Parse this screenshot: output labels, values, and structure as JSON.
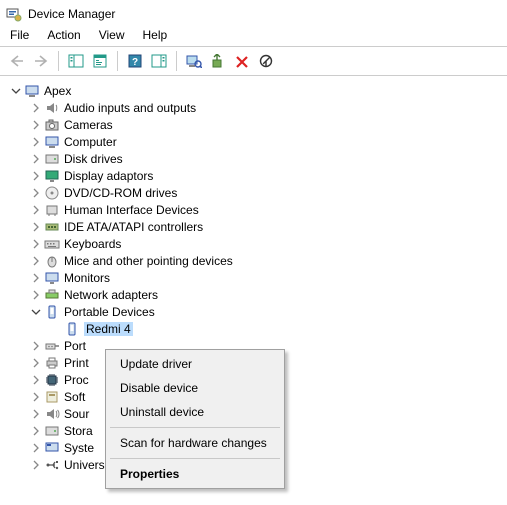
{
  "window": {
    "title": "Device Manager"
  },
  "menu": {
    "file": "File",
    "action": "Action",
    "view": "View",
    "help": "Help"
  },
  "tree": {
    "root": "Apex",
    "categories": [
      {
        "label": "Audio inputs and outputs"
      },
      {
        "label": "Cameras"
      },
      {
        "label": "Computer"
      },
      {
        "label": "Disk drives"
      },
      {
        "label": "Display adaptors"
      },
      {
        "label": "DVD/CD-ROM drives"
      },
      {
        "label": "Human Interface Devices"
      },
      {
        "label": "IDE ATA/ATAPI controllers"
      },
      {
        "label": "Keyboards"
      },
      {
        "label": "Mice and other pointing devices"
      },
      {
        "label": "Monitors"
      },
      {
        "label": "Network adapters"
      },
      {
        "label": "Portable Devices",
        "expanded": true,
        "children": [
          {
            "label": "Redmi 4",
            "selected": true
          }
        ]
      },
      {
        "label": "Port"
      },
      {
        "label": "Print"
      },
      {
        "label": "Proc"
      },
      {
        "label": "Soft"
      },
      {
        "label": "Sour"
      },
      {
        "label": "Stora"
      },
      {
        "label": "Syste"
      },
      {
        "label": "Universal Serial Bus controllers"
      }
    ]
  },
  "context_menu": {
    "items": [
      {
        "label": "Update driver"
      },
      {
        "label": "Disable device"
      },
      {
        "label": "Uninstall device"
      },
      {
        "sep": true
      },
      {
        "label": "Scan for hardware changes"
      },
      {
        "sep": true
      },
      {
        "label": "Properties",
        "bold": true
      }
    ]
  }
}
